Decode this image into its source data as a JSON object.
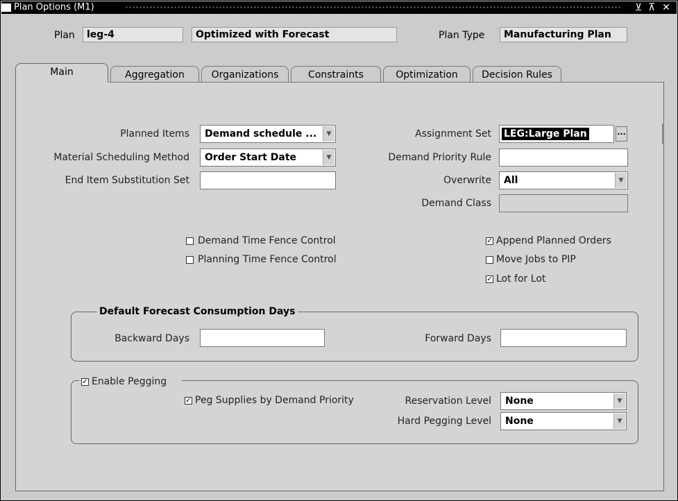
{
  "window": {
    "title": "Plan Options (M1)",
    "controls": {
      "minimize": "⊻",
      "maximize": "⊼",
      "close": "✕"
    }
  },
  "header": {
    "plan_label": "Plan",
    "plan_value": "leg-4",
    "plan_desc": "Optimized with Forecast",
    "plan_type_label": "Plan Type",
    "plan_type_value": "Manufacturing Plan"
  },
  "tabs": [
    {
      "label": "Main",
      "active": true
    },
    {
      "label": "Aggregation",
      "active": false
    },
    {
      "label": "Organizations",
      "active": false
    },
    {
      "label": "Constraints",
      "active": false
    },
    {
      "label": "Optimization",
      "active": false
    },
    {
      "label": "Decision Rules",
      "active": false
    }
  ],
  "main": {
    "left_fields": [
      {
        "label": "Planned Items",
        "value": "Demand schedule ...",
        "type": "dropdown"
      },
      {
        "label": "Material Scheduling Method",
        "value": "Order Start Date",
        "type": "dropdown"
      },
      {
        "label": "End Item Substitution Set",
        "value": "",
        "type": "text"
      }
    ],
    "right_fields": [
      {
        "label": "Assignment Set",
        "value": "LEG:Large Plan",
        "type": "lov",
        "selected": true
      },
      {
        "label": "Demand Priority Rule",
        "value": "",
        "type": "text"
      },
      {
        "label": "Overwrite",
        "value": "All",
        "type": "dropdown"
      },
      {
        "label": "Demand Class",
        "value": "",
        "type": "disabled"
      }
    ],
    "left_checks": [
      {
        "label": "Demand Time Fence Control",
        "checked": false
      },
      {
        "label": "Planning Time Fence Control",
        "checked": false
      }
    ],
    "right_checks": [
      {
        "label": "Append Planned Orders",
        "checked": true
      },
      {
        "label": "Move Jobs to PIP",
        "checked": false
      },
      {
        "label": "Lot for Lot",
        "checked": true
      }
    ],
    "lov_button": "..."
  },
  "forecast_group": {
    "title": "Default Forecast Consumption Days",
    "backward_label": "Backward Days",
    "backward_value": "",
    "forward_label": "Forward Days",
    "forward_value": ""
  },
  "pegging_group": {
    "enable_label": "Enable Pegging",
    "enable_checked": true,
    "peg_by_priority_label": "Peg Supplies by Demand Priority",
    "peg_by_priority_checked": true,
    "reservation_label": "Reservation Level",
    "reservation_value": "None",
    "hard_pegging_label": "Hard Pegging Level",
    "hard_pegging_value": "None"
  },
  "colors": {
    "titlebar": "#000000",
    "window_bg": "#cccccc",
    "panel_bg": "#d4d4d4",
    "selected_field_bg": "#000000"
  }
}
